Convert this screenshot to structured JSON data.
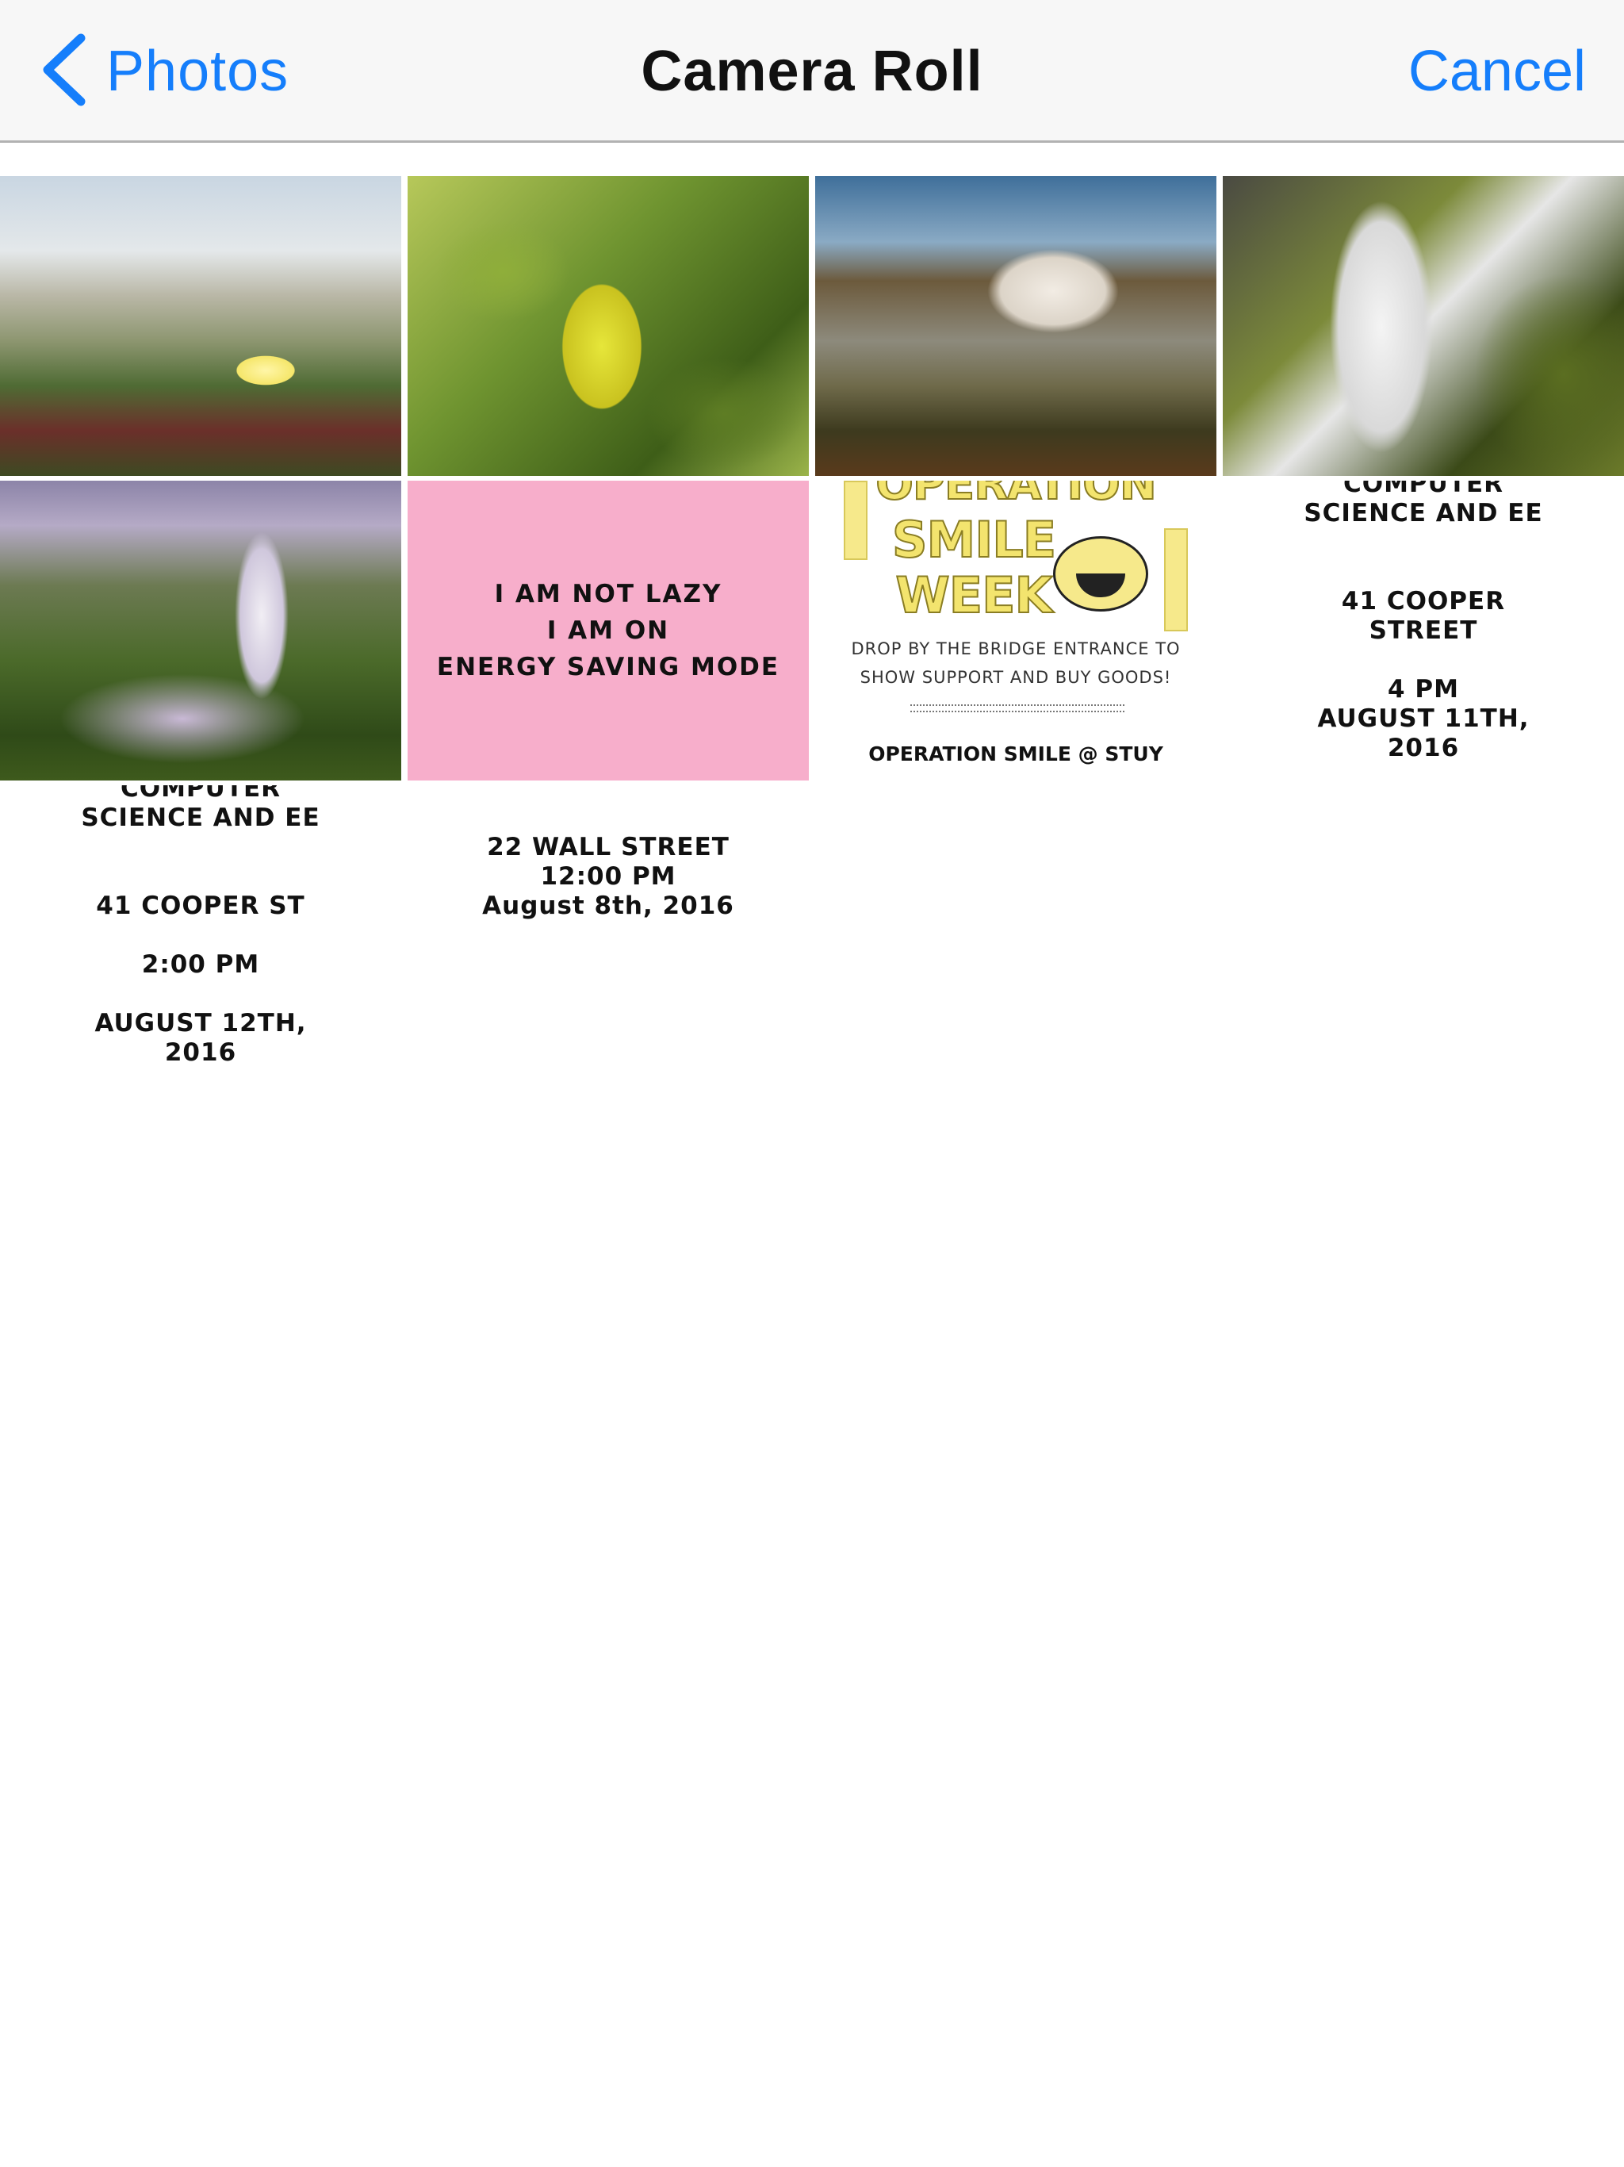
{
  "navbar": {
    "back_label": "Photos",
    "title": "Camera Roll",
    "cancel_label": "Cancel",
    "accent_color": "#157efb",
    "back_icon": "chevron-left-icon"
  },
  "grid": {
    "pink_card": {
      "line1": "I AM NOT LAZY",
      "line2": "I AM ON",
      "line3": "ENERGY SAVING MODE"
    },
    "poster": {
      "line1": "OPERATION",
      "line2": "SMILE",
      "line3": "WEEK",
      "line4": "DROP BY THE BRIDGE ENTRANCE TO",
      "line5": "SHOW SUPPORT AND BUY GOODS!",
      "line6": "OPERATION SMILE @ STUY"
    },
    "event_aug11": {
      "line1": "COMPUTER",
      "line2": "SCIENCE AND EE",
      "line3": "41 COOPER",
      "line4": "STREET",
      "line5": "4 PM",
      "line6": "AUGUST 11TH,",
      "line7": "2016"
    },
    "event_aug12": {
      "line1": "COMPUTER",
      "line2": "SCIENCE AND EE",
      "line3": "41 COOPER ST",
      "line4": "2:00 PM",
      "line5": "AUGUST 12TH,",
      "line6": "2016"
    },
    "event_aug8": {
      "line1": "22 WALL STREET",
      "line2": "12:00 PM",
      "line3": "August 8th, 2016"
    }
  }
}
